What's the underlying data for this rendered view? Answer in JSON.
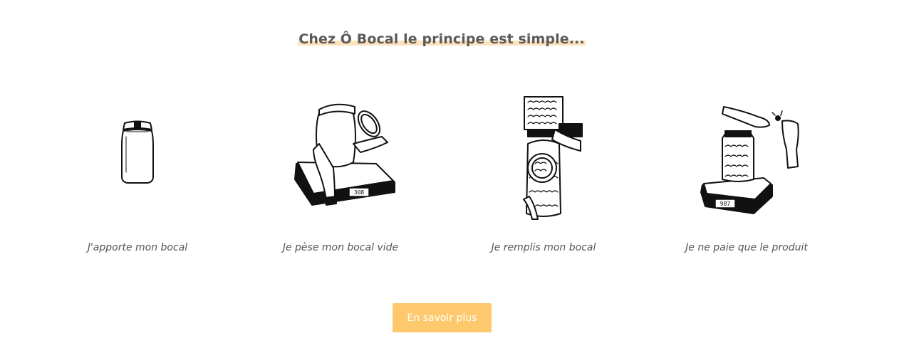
{
  "headline": "Chez Ô Bocal le principe est simple...",
  "steps": [
    {
      "label": "J'apporte mon bocal",
      "illustration": "jar-illustration"
    },
    {
      "label": "Je pèse mon bocal vide",
      "illustration": "weigh-empty-jar-illustration",
      "scale_display": "308"
    },
    {
      "label": "Je remplis mon bocal",
      "illustration": "fill-jar-illustration"
    },
    {
      "label": "Je ne paie que le produit",
      "illustration": "pay-product-illustration",
      "scale_display": "987"
    }
  ],
  "cta": {
    "label": "En savoir plus"
  },
  "colors": {
    "accent": "#fec96c",
    "highlight": "#fde3bd",
    "text": "#555555"
  }
}
